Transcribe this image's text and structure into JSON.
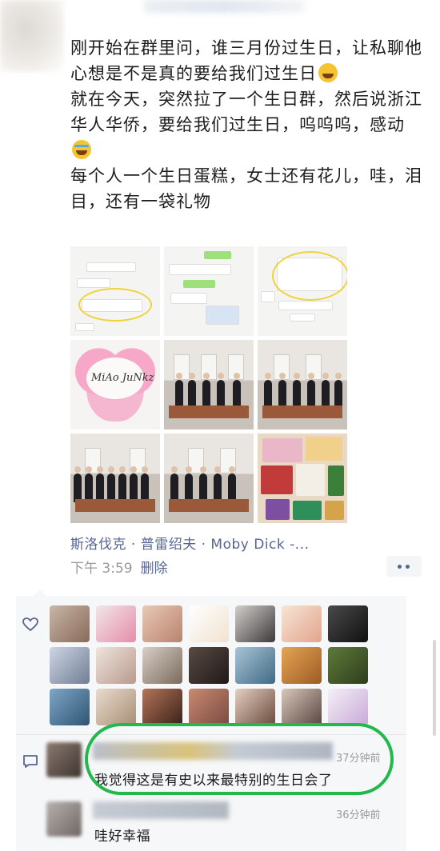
{
  "post": {
    "lines": [
      "刚开始在群里问，谁三月份过生日，让私聊他",
      "心想是不是真的要给我们过生日",
      "就在今天，突然拉了一个生日群，然后说浙江华人华侨，要给我们过生日，呜呜呜，感动",
      "每个人一个生日蛋糕，女士还有花儿，哇，泪目，还有一袋礼物"
    ],
    "emojis": [
      "tears-of-joy-emoji",
      "crying-emoji"
    ],
    "cake_text": "MiAo JuNkz",
    "location": "斯洛伐克 · 普雷绍夫 · Moby Dick -...",
    "time": "下午 3:59",
    "delete_label": "删除"
  },
  "likes": {
    "count_avatars": 21
  },
  "comments": [
    {
      "time": "37分钟前",
      "text": "我觉得这是有史以来最特别的生日会了"
    },
    {
      "time": "36分钟前",
      "text": "哇好幸福"
    }
  ],
  "colors": {
    "link": "#56678f",
    "highlight": "#22b84b",
    "panel_bg": "#f6f7f8"
  }
}
